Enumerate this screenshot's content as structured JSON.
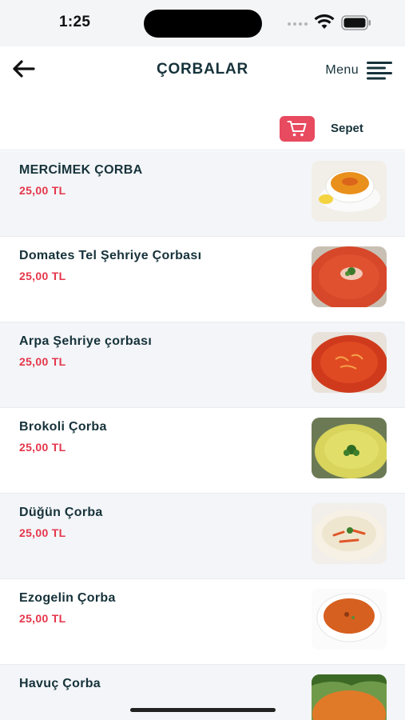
{
  "status": {
    "time": "1:25"
  },
  "header": {
    "title": "ÇORBALAR",
    "menu_label": "Menu"
  },
  "cart": {
    "label": "Sepet",
    "accent_color": "#e84a5f"
  },
  "colors": {
    "price": "#e5364b",
    "text": "#16323a",
    "row_alt": "#f3f5f8"
  },
  "items": [
    {
      "name": "MERCİMEK ÇORBA",
      "price": "25,00 TL",
      "image_icon": "lentil-soup-photo"
    },
    {
      "name": "Domates Tel Şehriye Çorbası",
      "price": "25,00 TL",
      "image_icon": "tomato-soup-photo"
    },
    {
      "name": "Arpa Şehriye çorbası",
      "price": "25,00 TL",
      "image_icon": "orzo-soup-photo"
    },
    {
      "name": "Brokoli Çorba",
      "price": "25,00 TL",
      "image_icon": "broccoli-soup-photo"
    },
    {
      "name": "Düğün Çorba",
      "price": "25,00 TL",
      "image_icon": "wedding-soup-photo"
    },
    {
      "name": "Ezogelin Çorba",
      "price": "25,00 TL",
      "image_icon": "ezogelin-soup-photo"
    },
    {
      "name": "Havuç Çorba",
      "price": "",
      "image_icon": "carrot-soup-photo"
    }
  ]
}
